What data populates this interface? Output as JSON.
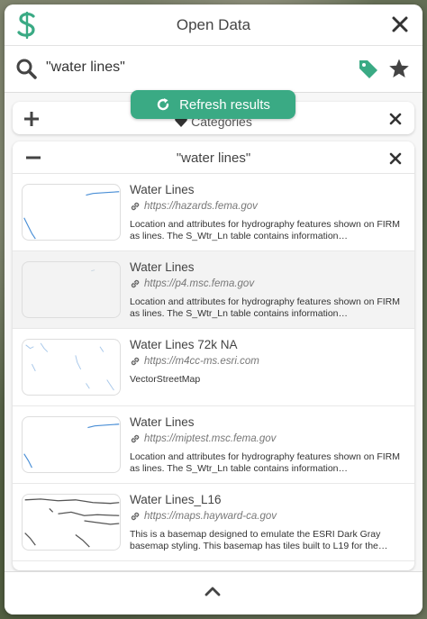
{
  "header": {
    "title": "Open Data"
  },
  "search": {
    "query": "\"water lines\""
  },
  "refresh": {
    "label": "Refresh results"
  },
  "categories": {
    "label": "Categories"
  },
  "results": {
    "heading": "\"water lines\"",
    "items": [
      {
        "title": "Water Lines",
        "url": "https://hazards.fema.gov",
        "desc": "Location and attributes for hydrography features shown on FIRM as lines. The S_Wtr_Ln table contains information…"
      },
      {
        "title": "Water Lines",
        "url": "https://p4.msc.fema.gov",
        "desc": "Location and attributes for hydrography features shown on FIRM as lines. The S_Wtr_Ln table contains information…"
      },
      {
        "title": "Water Lines 72k NA",
        "url": "https://m4cc-ms.esri.com",
        "desc": "VectorStreetMap"
      },
      {
        "title": "Water Lines",
        "url": "https://miptest.msc.fema.gov",
        "desc": "Location and attributes for hydrography features shown on FIRM as lines. The S_Wtr_Ln table contains information…"
      },
      {
        "title": "Water Lines_L16",
        "url": "https://maps.hayward-ca.gov",
        "desc": "This is a basemap designed to emulate the ESRI Dark Gray basemap styling. This basemap has tiles built to L19 for the…"
      }
    ]
  },
  "colors": {
    "accent": "#3aaa84",
    "water": "#4a8fd6"
  }
}
